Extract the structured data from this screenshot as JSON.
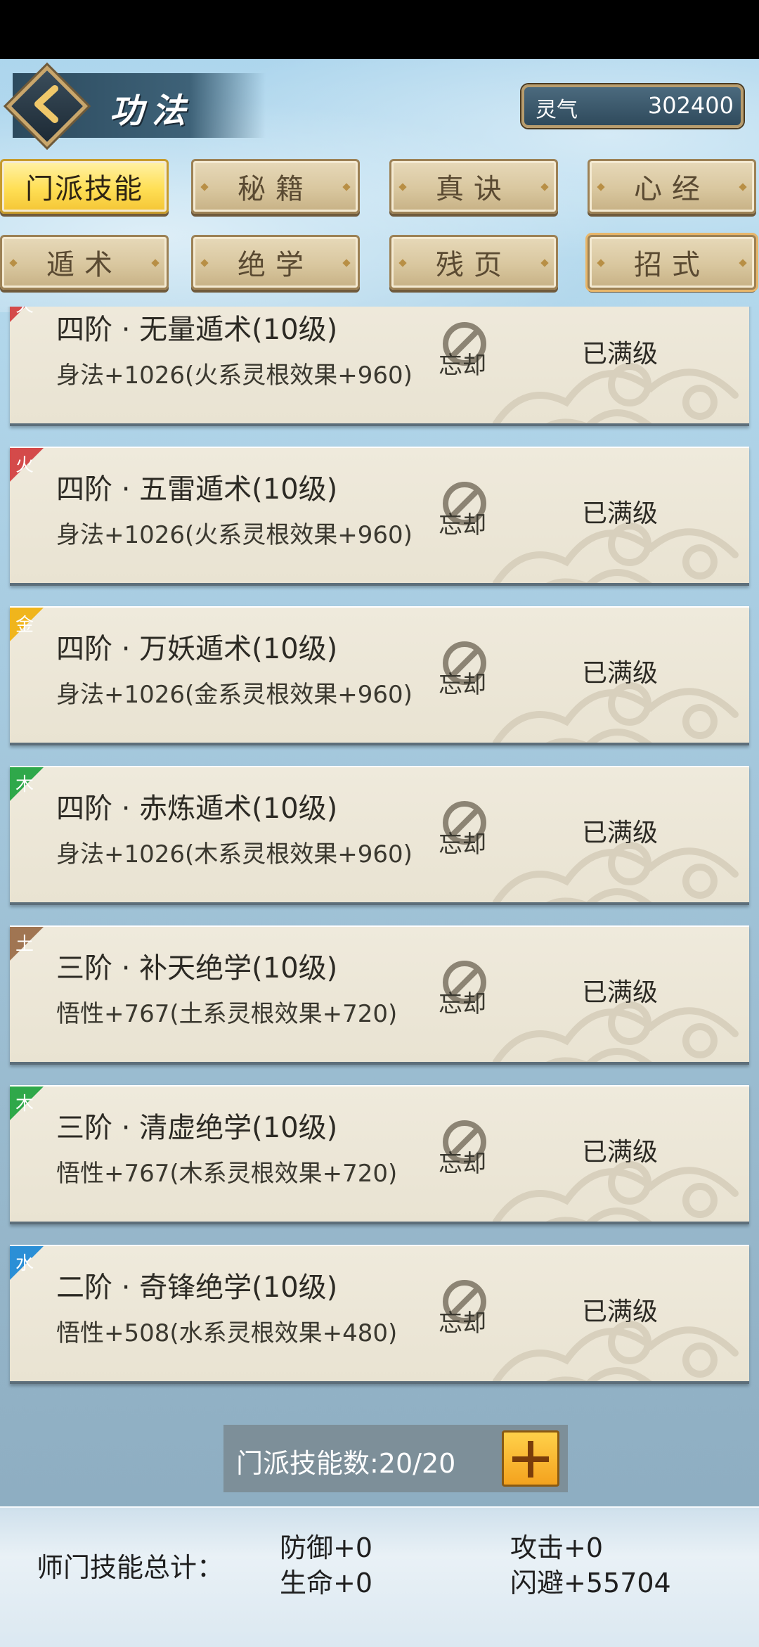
{
  "header": {
    "title": "功法",
    "currency_label": "灵气",
    "currency_value": "302400"
  },
  "tabs": [
    {
      "label": "门派技能",
      "active": true
    },
    {
      "label": "秘籍"
    },
    {
      "label": "真诀"
    },
    {
      "label": "心经"
    },
    {
      "label": "遁术"
    },
    {
      "label": "绝学"
    },
    {
      "label": "残页"
    },
    {
      "label": "招式"
    }
  ],
  "skills": [
    {
      "element": "火",
      "element_color": "#d44a4a",
      "name": "四阶 · 无量遁术(10级)",
      "effect": "身法+1026(火系灵根效果+960)",
      "forget_label": "忘却",
      "status": "已满级"
    },
    {
      "element": "火",
      "element_color": "#d44a4a",
      "name": "四阶 · 五雷遁术(10级)",
      "effect": "身法+1026(火系灵根效果+960)",
      "forget_label": "忘却",
      "status": "已满级"
    },
    {
      "element": "金",
      "element_color": "#f0b51c",
      "name": "四阶 · 万妖遁术(10级)",
      "effect": "身法+1026(金系灵根效果+960)",
      "forget_label": "忘却",
      "status": "已满级"
    },
    {
      "element": "木",
      "element_color": "#2fa84a",
      "name": "四阶 · 赤炼遁术(10级)",
      "effect": "身法+1026(木系灵根效果+960)",
      "forget_label": "忘却",
      "status": "已满级"
    },
    {
      "element": "土",
      "element_color": "#a07552",
      "name": "三阶 · 补天绝学(10级)",
      "effect": "悟性+767(土系灵根效果+720)",
      "forget_label": "忘却",
      "status": "已满级"
    },
    {
      "element": "木",
      "element_color": "#2fa84a",
      "name": "三阶 · 清虚绝学(10级)",
      "effect": "悟性+767(木系灵根效果+720)",
      "forget_label": "忘却",
      "status": "已满级"
    },
    {
      "element": "水",
      "element_color": "#2b8fd6",
      "name": "二阶 · 奇锋绝学(10级)",
      "effect": "悟性+508(水系灵根效果+480)",
      "forget_label": "忘却",
      "status": "已满级"
    }
  ],
  "skill_count": "门派技能数:20/20",
  "totals": {
    "label": "师门技能总计：",
    "defense": "防御+0",
    "attack": "攻击+0",
    "hp": "生命+0",
    "dodge": "闪避+55704"
  }
}
